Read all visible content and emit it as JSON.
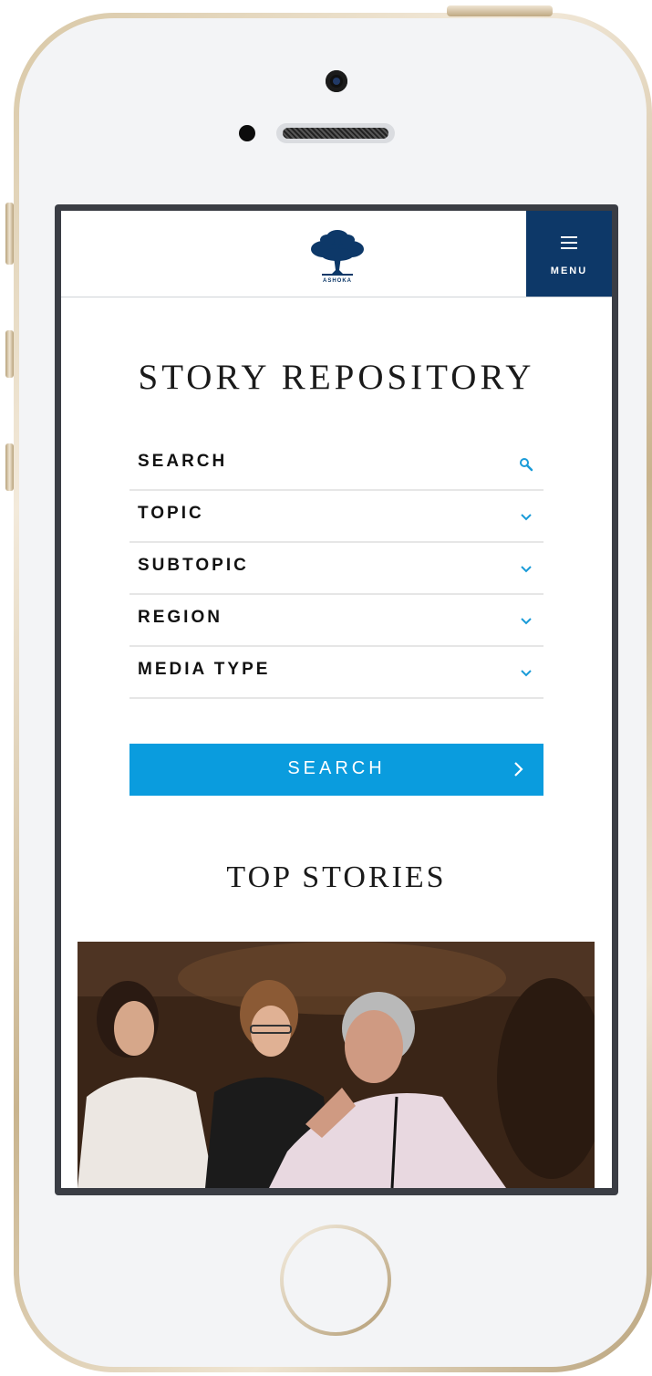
{
  "header": {
    "logo_text": "ASHOKA",
    "menu_label": "MENU",
    "brand_color": "#0d3868"
  },
  "page": {
    "title": "STORY REPOSITORY"
  },
  "filters": [
    {
      "label": "SEARCH",
      "icon": "search-icon"
    },
    {
      "label": "TOPIC",
      "icon": "chevron-down-icon"
    },
    {
      "label": "SUBTOPIC",
      "icon": "chevron-down-icon"
    },
    {
      "label": "REGION",
      "icon": "chevron-down-icon"
    },
    {
      "label": "MEDIA TYPE",
      "icon": "chevron-down-icon"
    }
  ],
  "search_button": {
    "label": "SEARCH",
    "color": "#0a9cde",
    "icon": "chevron-right-icon"
  },
  "top_stories": {
    "title": "TOP STORIES"
  },
  "colors": {
    "accent": "#0a9cde",
    "icon_accent": "#1a9bd8"
  }
}
